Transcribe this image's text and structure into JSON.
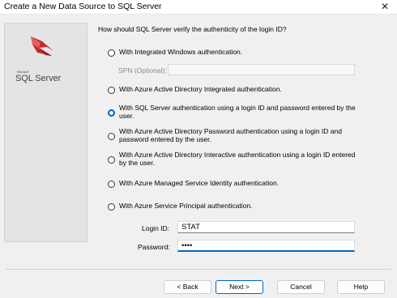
{
  "window": {
    "title": "Create a New Data Source to SQL Server"
  },
  "logo": {
    "microsoft": "Microsoft",
    "name": "SQL Server"
  },
  "question": "How should SQL Server verify the authenticity of the login ID?",
  "options": [
    {
      "label": "With Integrated Windows authentication.",
      "selected": false
    },
    {
      "label": "With Azure Active Directory Integrated authentication.",
      "selected": false
    },
    {
      "label": "With SQL Server authentication using a login ID and password entered by the user.",
      "selected": true
    },
    {
      "label": "With Azure Active Directory Password authentication using a login ID and password entered by the user.",
      "selected": false
    },
    {
      "label": "With Azure Active Directory Interactive authentication using a login ID entered by the user.",
      "selected": false
    },
    {
      "label": "With Azure Managed Service Identity authentication.",
      "selected": false
    },
    {
      "label": "With Azure Service Principal authentication.",
      "selected": false
    }
  ],
  "spn": {
    "label": "SPN (Optional):",
    "value": ""
  },
  "login": {
    "label": "Login ID:",
    "value": "STAT"
  },
  "password": {
    "label": "Password:",
    "value": "••••"
  },
  "buttons": {
    "back": "< Back",
    "next": "Next >",
    "cancel": "Cancel",
    "help": "Help"
  },
  "colors": {
    "accent": "#0067c0",
    "background": "#f0f0f0"
  },
  "icons": {
    "close": "close-icon",
    "logo": "sql-server-logo-icon"
  }
}
